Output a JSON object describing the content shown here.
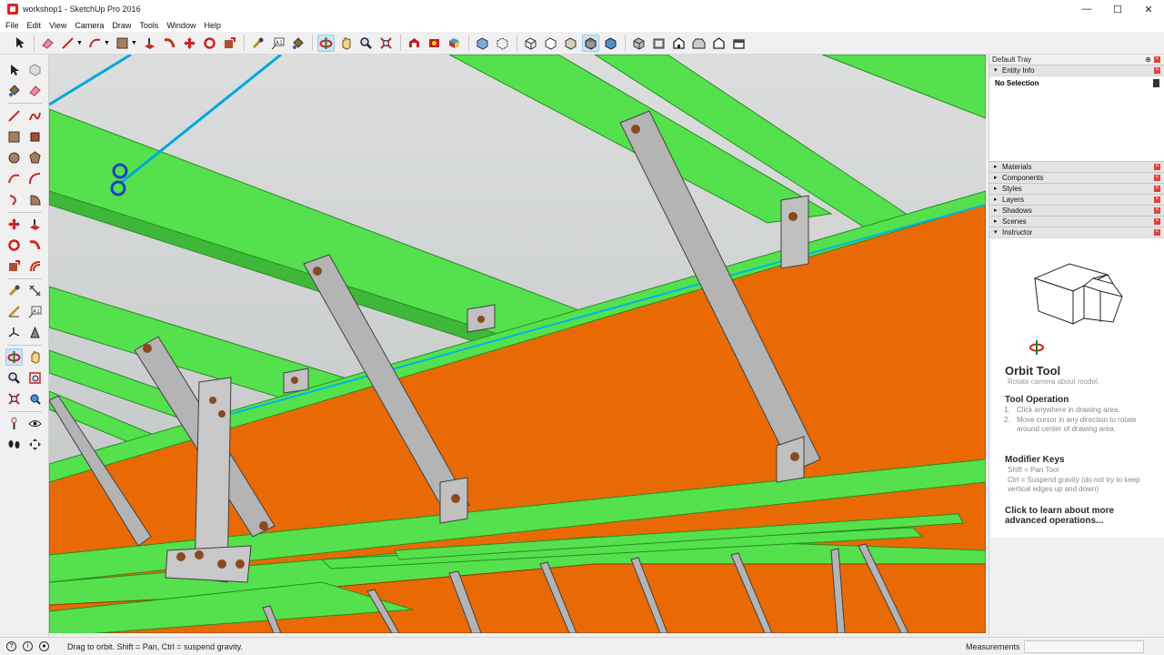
{
  "window": {
    "title": "workshop1 - SketchUp Pro 2016",
    "controls": [
      "—",
      "☐",
      "✕"
    ]
  },
  "menu": [
    "File",
    "Edit",
    "View",
    "Camera",
    "Draw",
    "Tools",
    "Window",
    "Help"
  ],
  "toolbar": {
    "icons": [
      "select-icon",
      "eraser-icon",
      "line-icon",
      "arc-icon",
      "shape-icon",
      "push-pull-icon",
      "follow-me-icon",
      "move-icon",
      "rotate-icon",
      "scale-icon",
      "tape-measure-icon",
      "text-icon",
      "paint-bucket-icon",
      "orbit-icon",
      "pan-icon",
      "zoom-icon",
      "zoom-extents-icon",
      "warehouse-icon",
      "extension-icon",
      "component-icon",
      "x-ray-icon",
      "back-edges-icon",
      "wireframe-icon",
      "hidden-line-icon",
      "shaded-icon",
      "textured-icon",
      "monochrome-icon",
      "iso-view-icon",
      "top-view-icon",
      "front-view-icon",
      "right-view-icon",
      "back-view-icon",
      "left-view-icon"
    ]
  },
  "tray": {
    "title": "Default Tray",
    "entity_info": {
      "label": "Entity Info",
      "selection": "No Selection"
    },
    "panels": [
      "Materials",
      "Components",
      "Styles",
      "Layers",
      "Shadows",
      "Scenes"
    ],
    "instructor": {
      "label": "Instructor",
      "tool_name": "Orbit Tool",
      "tool_desc": "Rotate camera about model.",
      "operation_heading": "Tool Operation",
      "operation_steps": [
        {
          "num": "1.",
          "text": "Click anywhere in drawing area."
        },
        {
          "num": "2.",
          "text": "Move cursor in any direction to rotate around center of drawing area."
        }
      ],
      "modifier_heading": "Modifier Keys",
      "modifier_lines": [
        "Shift = Pan Tool",
        "Ctrl = Suspend gravity (do not try to keep vertical edges up and down)"
      ],
      "more_link": "Click to learn about more advanced operations..."
    }
  },
  "status": {
    "message": "Drag to orbit. Shift = Pan, Ctrl = suspend gravity.",
    "measurements_label": "Measurements",
    "measurements_value": ""
  },
  "colors": {
    "beam_green": "#53e24f",
    "panel_orange": "#e96a05",
    "brace_gray": "#b4b4b4",
    "sky": "#cfd1d2",
    "guide_cyan": "#00b4e6"
  }
}
